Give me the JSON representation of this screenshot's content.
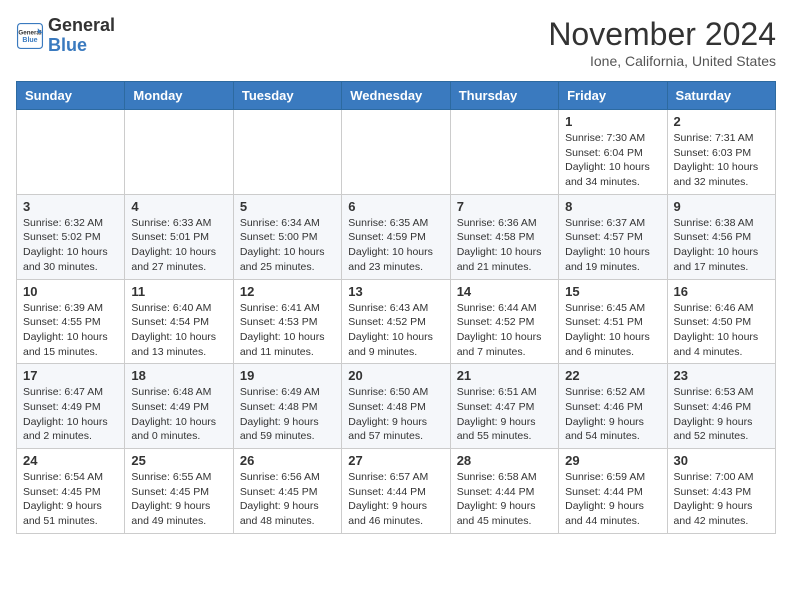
{
  "header": {
    "logo_general": "General",
    "logo_blue": "Blue",
    "month_title": "November 2024",
    "location": "Ione, California, United States"
  },
  "days_of_week": [
    "Sunday",
    "Monday",
    "Tuesday",
    "Wednesday",
    "Thursday",
    "Friday",
    "Saturday"
  ],
  "weeks": [
    [
      {
        "day": "",
        "info": ""
      },
      {
        "day": "",
        "info": ""
      },
      {
        "day": "",
        "info": ""
      },
      {
        "day": "",
        "info": ""
      },
      {
        "day": "",
        "info": ""
      },
      {
        "day": "1",
        "info": "Sunrise: 7:30 AM\nSunset: 6:04 PM\nDaylight: 10 hours and 34 minutes."
      },
      {
        "day": "2",
        "info": "Sunrise: 7:31 AM\nSunset: 6:03 PM\nDaylight: 10 hours and 32 minutes."
      }
    ],
    [
      {
        "day": "3",
        "info": "Sunrise: 6:32 AM\nSunset: 5:02 PM\nDaylight: 10 hours and 30 minutes."
      },
      {
        "day": "4",
        "info": "Sunrise: 6:33 AM\nSunset: 5:01 PM\nDaylight: 10 hours and 27 minutes."
      },
      {
        "day": "5",
        "info": "Sunrise: 6:34 AM\nSunset: 5:00 PM\nDaylight: 10 hours and 25 minutes."
      },
      {
        "day": "6",
        "info": "Sunrise: 6:35 AM\nSunset: 4:59 PM\nDaylight: 10 hours and 23 minutes."
      },
      {
        "day": "7",
        "info": "Sunrise: 6:36 AM\nSunset: 4:58 PM\nDaylight: 10 hours and 21 minutes."
      },
      {
        "day": "8",
        "info": "Sunrise: 6:37 AM\nSunset: 4:57 PM\nDaylight: 10 hours and 19 minutes."
      },
      {
        "day": "9",
        "info": "Sunrise: 6:38 AM\nSunset: 4:56 PM\nDaylight: 10 hours and 17 minutes."
      }
    ],
    [
      {
        "day": "10",
        "info": "Sunrise: 6:39 AM\nSunset: 4:55 PM\nDaylight: 10 hours and 15 minutes."
      },
      {
        "day": "11",
        "info": "Sunrise: 6:40 AM\nSunset: 4:54 PM\nDaylight: 10 hours and 13 minutes."
      },
      {
        "day": "12",
        "info": "Sunrise: 6:41 AM\nSunset: 4:53 PM\nDaylight: 10 hours and 11 minutes."
      },
      {
        "day": "13",
        "info": "Sunrise: 6:43 AM\nSunset: 4:52 PM\nDaylight: 10 hours and 9 minutes."
      },
      {
        "day": "14",
        "info": "Sunrise: 6:44 AM\nSunset: 4:52 PM\nDaylight: 10 hours and 7 minutes."
      },
      {
        "day": "15",
        "info": "Sunrise: 6:45 AM\nSunset: 4:51 PM\nDaylight: 10 hours and 6 minutes."
      },
      {
        "day": "16",
        "info": "Sunrise: 6:46 AM\nSunset: 4:50 PM\nDaylight: 10 hours and 4 minutes."
      }
    ],
    [
      {
        "day": "17",
        "info": "Sunrise: 6:47 AM\nSunset: 4:49 PM\nDaylight: 10 hours and 2 minutes."
      },
      {
        "day": "18",
        "info": "Sunrise: 6:48 AM\nSunset: 4:49 PM\nDaylight: 10 hours and 0 minutes."
      },
      {
        "day": "19",
        "info": "Sunrise: 6:49 AM\nSunset: 4:48 PM\nDaylight: 9 hours and 59 minutes."
      },
      {
        "day": "20",
        "info": "Sunrise: 6:50 AM\nSunset: 4:48 PM\nDaylight: 9 hours and 57 minutes."
      },
      {
        "day": "21",
        "info": "Sunrise: 6:51 AM\nSunset: 4:47 PM\nDaylight: 9 hours and 55 minutes."
      },
      {
        "day": "22",
        "info": "Sunrise: 6:52 AM\nSunset: 4:46 PM\nDaylight: 9 hours and 54 minutes."
      },
      {
        "day": "23",
        "info": "Sunrise: 6:53 AM\nSunset: 4:46 PM\nDaylight: 9 hours and 52 minutes."
      }
    ],
    [
      {
        "day": "24",
        "info": "Sunrise: 6:54 AM\nSunset: 4:45 PM\nDaylight: 9 hours and 51 minutes."
      },
      {
        "day": "25",
        "info": "Sunrise: 6:55 AM\nSunset: 4:45 PM\nDaylight: 9 hours and 49 minutes."
      },
      {
        "day": "26",
        "info": "Sunrise: 6:56 AM\nSunset: 4:45 PM\nDaylight: 9 hours and 48 minutes."
      },
      {
        "day": "27",
        "info": "Sunrise: 6:57 AM\nSunset: 4:44 PM\nDaylight: 9 hours and 46 minutes."
      },
      {
        "day": "28",
        "info": "Sunrise: 6:58 AM\nSunset: 4:44 PM\nDaylight: 9 hours and 45 minutes."
      },
      {
        "day": "29",
        "info": "Sunrise: 6:59 AM\nSunset: 4:44 PM\nDaylight: 9 hours and 44 minutes."
      },
      {
        "day": "30",
        "info": "Sunrise: 7:00 AM\nSunset: 4:43 PM\nDaylight: 9 hours and 42 minutes."
      }
    ]
  ]
}
